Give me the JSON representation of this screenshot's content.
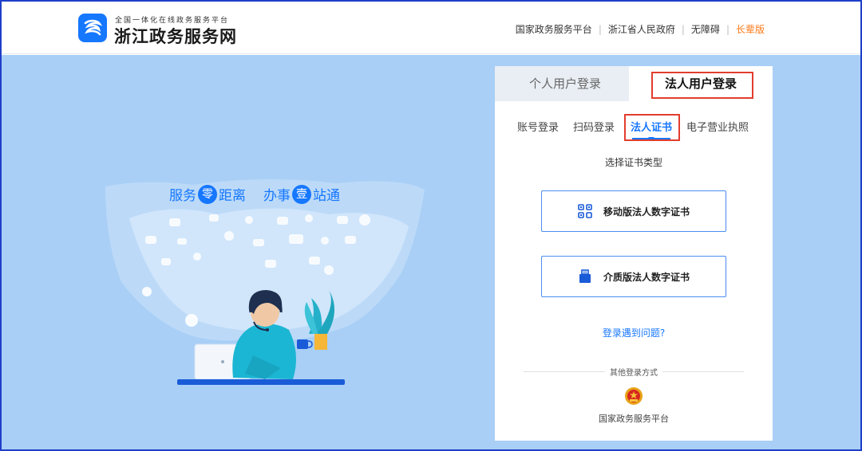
{
  "header": {
    "logo_subtitle": "全国一体化在线政务服务平台",
    "logo_title": "浙江政务服务网",
    "links": [
      {
        "label": "国家政务服务平台"
      },
      {
        "label": "浙江省人民政府"
      },
      {
        "label": "无障碍"
      },
      {
        "label": "长辈版"
      }
    ]
  },
  "slogan": {
    "part1": "服务",
    "circle1": "零",
    "part2": "距离",
    "part3": "办事",
    "circle2": "壹",
    "part4": "站通"
  },
  "login": {
    "tabs": {
      "personal": "个人用户登录",
      "legal": "法人用户登录"
    },
    "subtabs": [
      "账号登录",
      "扫码登录",
      "法人证书",
      "电子营业执照"
    ],
    "active_subtab": "法人证书",
    "cert_type_title": "选择证书类型",
    "cert_buttons": {
      "mobile": "移动版法人数字证书",
      "media": "介质版法人数字证书"
    },
    "problem_link": "登录遇到问题?",
    "other_methods_label": "其他登录方式",
    "national_platform": "国家政务服务平台"
  },
  "colors": {
    "accent": "#1677ff",
    "background": "#a9cff6",
    "highlight_border": "#e23d2e",
    "elder_link": "#ff7a1a"
  }
}
